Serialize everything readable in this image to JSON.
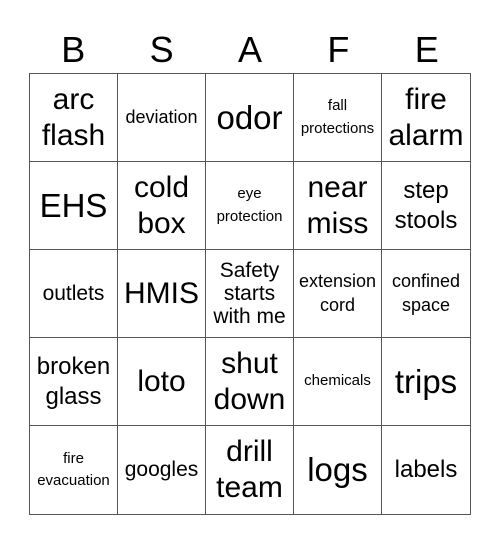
{
  "header": {
    "letters": [
      "B",
      "S",
      "A",
      "F",
      "E"
    ]
  },
  "cells": [
    "arc flash",
    "deviation",
    "odor",
    "fall protections",
    "fire alarm",
    "EHS",
    "cold box",
    "eye protection",
    "near miss",
    "step stools",
    "outlets",
    "HMIS",
    "Safety starts with me",
    "extension cord",
    "confined space",
    "broken glass",
    "loto",
    "shut down",
    "chemicals",
    "trips",
    "fire evacuation",
    "googles",
    "drill team",
    "logs",
    "labels"
  ]
}
